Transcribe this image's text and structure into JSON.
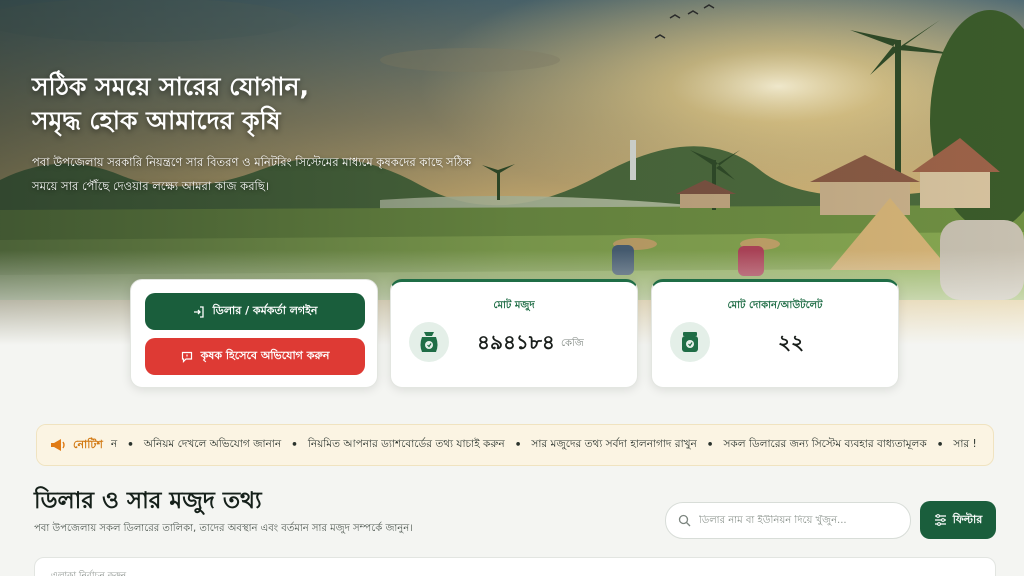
{
  "hero": {
    "title_line1": "সঠিক সময়ে সারের যোগান,",
    "title_line2": "সমৃদ্ধ হোক আমাদের কৃষি",
    "description": "পবা উপজেলায় সরকারি নিয়ন্ত্রণে সার বিতরণ ও মনিটরিং সিস্টেমের মাধ্যমে কৃষকদের কাছে সঠিক সময়ে সার পৌঁছে দেওয়ার লক্ষ্যে আমরা কাজ করছি।"
  },
  "actions": {
    "login_label": "ডিলার / কর্মকর্তা লগইন",
    "complaint_label": "কৃষক হিসেবে অভিযোগ করুন"
  },
  "stats": {
    "stock_label": "মোট মজুদ",
    "stock_value": "৪৯৪১৮৪",
    "stock_unit": "কেজি",
    "shops_label": "মোট দোকান/আউটলেট",
    "shops_value": "২২"
  },
  "notice": {
    "label": "নোটিশ",
    "items": [
      "ন",
      "অনিয়ম দেখলে অভিযোগ জানান",
      "নিয়মিত আপনার ড্যাশবোর্ডের তথ্য যাচাই করুন",
      "সার মজুদের তথ্য সর্বদা হালনাগাদ রাখুন",
      "সকল ডিলারের জন্য সিস্টেম ব্যবহার বাধ্যতামূলক",
      "সার !"
    ]
  },
  "section": {
    "title": "ডিলার ও সার মজুদ তথ্য",
    "subtitle": "পবা উপজেলায় সকল ডিলারের তালিকা, তাদের অবস্থান এবং বর্তমান সার মজুদ সম্পর্কে জানুন।",
    "search_placeholder": "ডিলার নাম বা ইউনিয়ন দিয়ে খুঁজুন...",
    "filter_label": "ফিল্টার",
    "panel_text": "এলাকা নির্বাচন করুন"
  },
  "colors": {
    "primary": "#1a5e3c",
    "danger": "#de3a34",
    "notice_bg": "#fbf4e3",
    "notice_accent": "#d27a14"
  }
}
